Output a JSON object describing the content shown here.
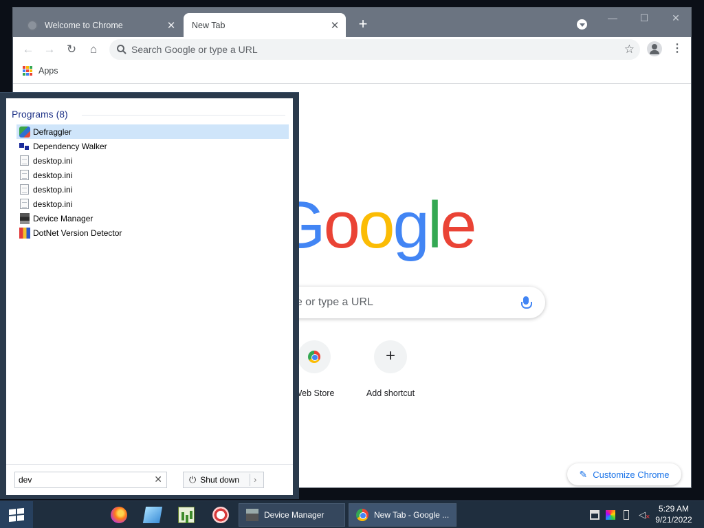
{
  "browser": {
    "tabs": [
      {
        "title": "Welcome to Chrome",
        "active": false
      },
      {
        "title": "New Tab",
        "active": true
      }
    ],
    "new_tab_symbol": "+",
    "window_controls": {
      "minimize": "—",
      "maximize": "☐",
      "close": "✕"
    },
    "omnibox_placeholder": "Search Google or type a URL",
    "bookmarks": {
      "apps_label": "Apps"
    },
    "ntp": {
      "logo_letters": [
        "G",
        "o",
        "o",
        "g",
        "l",
        "e"
      ],
      "logo_colors": [
        "#4285f4",
        "#ea4335",
        "#fbbc05",
        "#4285f4",
        "#34a853",
        "#ea4335"
      ],
      "search_placeholder": "Search Google or type a URL",
      "shortcuts": [
        {
          "label": "Web Store"
        },
        {
          "label": "Add shortcut",
          "symbol": "+"
        }
      ],
      "customize_label": "Customize Chrome"
    }
  },
  "start_menu": {
    "section_header": "Programs (8)",
    "items": [
      {
        "label": "Defraggler",
        "icon": "defraggler-icon",
        "selected": true
      },
      {
        "label": "Dependency Walker",
        "icon": "dependency-walker-icon"
      },
      {
        "label": "desktop.ini",
        "icon": "file-icon"
      },
      {
        "label": "desktop.ini",
        "icon": "file-icon"
      },
      {
        "label": "desktop.ini",
        "icon": "file-icon"
      },
      {
        "label": "desktop.ini",
        "icon": "file-icon"
      },
      {
        "label": "Device Manager",
        "icon": "device-manager-icon"
      },
      {
        "label": "DotNet Version Detector",
        "icon": "dotnet-icon"
      }
    ],
    "search_value": "dev",
    "shutdown_label": "Shut down"
  },
  "taskbar": {
    "pinned": [
      "firefox-icon",
      "notes-icon",
      "chart-icon",
      "snipping-icon"
    ],
    "tasks": [
      {
        "label": "Device Manager"
      },
      {
        "label": "New Tab - Google ..."
      }
    ],
    "clock": {
      "time": "5:29 AM",
      "date": "9/21/2022"
    }
  },
  "colors": {
    "chrome_frame": "#6b7481",
    "accent_blue": "#1a73e8",
    "start_menu_frame": "#2a3a4c",
    "taskbar": "#1f2e3e",
    "selection": "#cfe5fa"
  }
}
